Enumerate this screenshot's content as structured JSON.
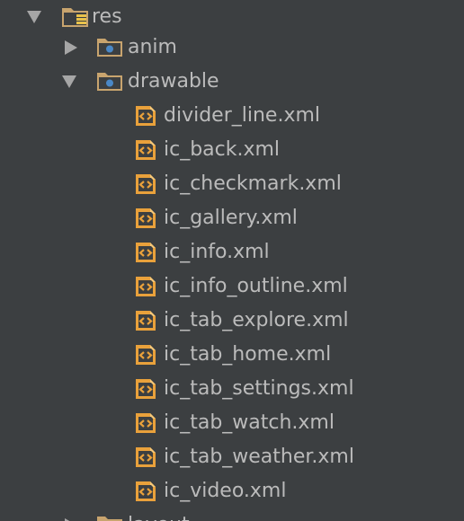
{
  "tree": {
    "res": {
      "label": "res",
      "expanded": true,
      "icon": "resource-folder-icon"
    },
    "anim": {
      "label": "anim",
      "expanded": false,
      "icon": "folder-icon"
    },
    "drawable": {
      "label": "drawable",
      "expanded": true,
      "icon": "folder-icon"
    },
    "files": [
      "divider_line.xml",
      "ic_back.xml",
      "ic_checkmark.xml",
      "ic_gallery.xml",
      "ic_info.xml",
      "ic_info_outline.xml",
      "ic_tab_explore.xml",
      "ic_tab_home.xml",
      "ic_tab_settings.xml",
      "ic_tab_watch.xml",
      "ic_tab_weather.xml",
      "ic_video.xml"
    ],
    "file_icon": "xml-file-icon",
    "next_folder": {
      "label": "layout",
      "expanded": false,
      "icon": "folder-icon"
    }
  },
  "colors": {
    "background": "#3c3f41",
    "text": "#bbbbbb",
    "arrow": "#a6a6a6",
    "folder": "#c8a46e",
    "folder_dot": "#4a88c7",
    "xml_icon": "#e9a13b"
  }
}
